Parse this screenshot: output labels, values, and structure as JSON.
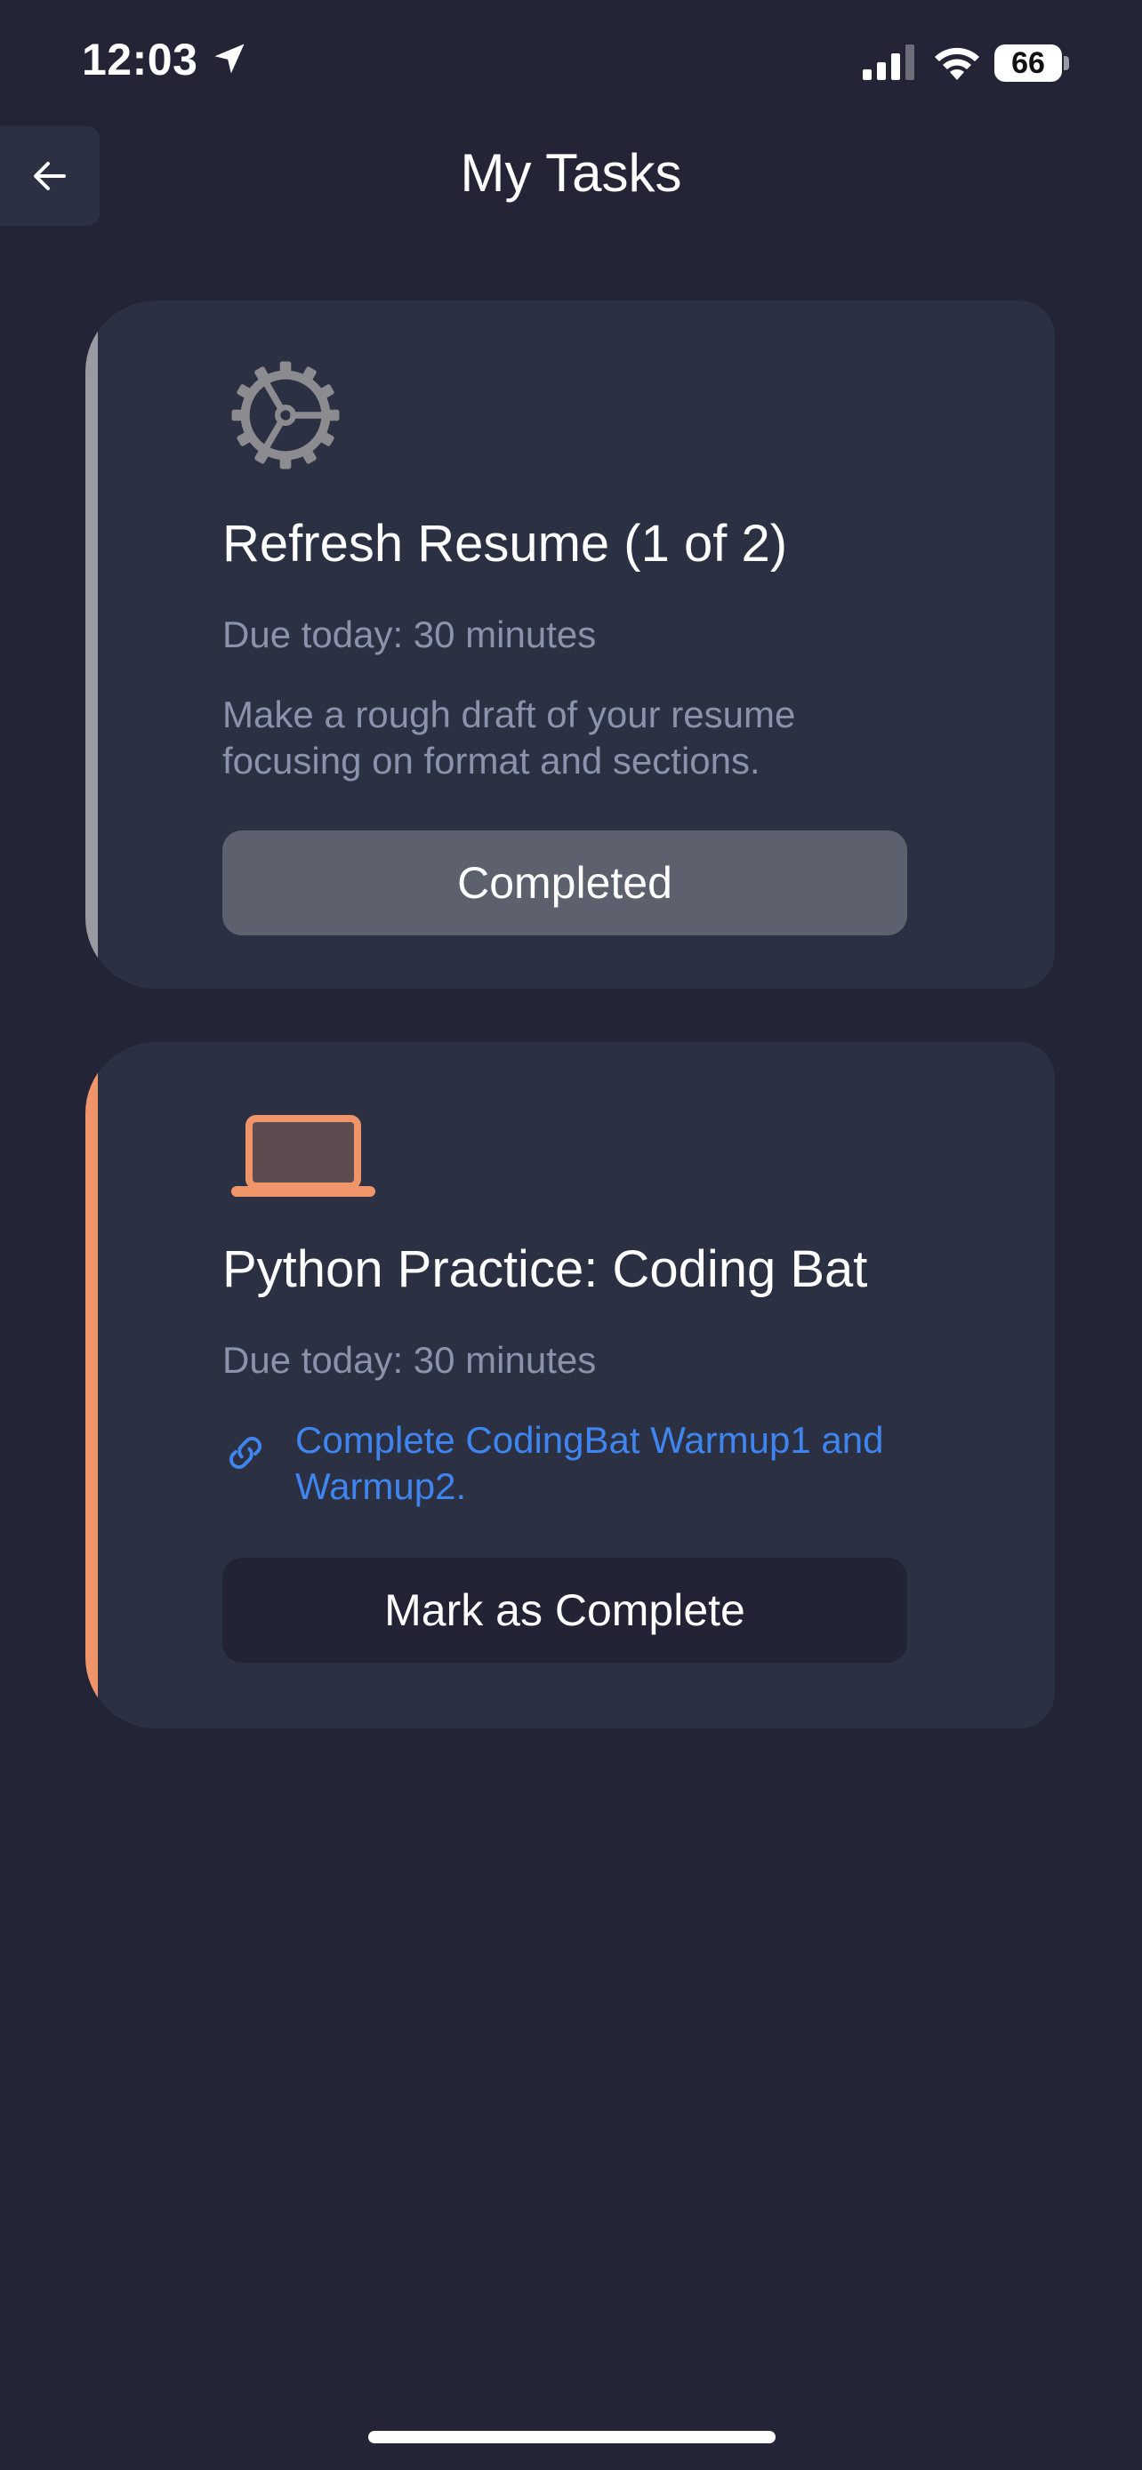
{
  "status_bar": {
    "time": "12:03",
    "battery_level": "66",
    "icons": [
      "location-arrow-icon",
      "cellular-signal-icon",
      "wifi-icon",
      "battery-icon"
    ]
  },
  "header": {
    "title": "My Tasks",
    "back_icon": "arrow-left-icon"
  },
  "tasks": [
    {
      "icon": "gear-icon",
      "title": "Refresh Resume (1 of 2)",
      "due": "Due today: 30 minutes",
      "description": "Make a rough draft of your resume focusing on format and sections.",
      "button_label": "Completed",
      "accent_color": "#9a9ba2",
      "button_color": "#5d606d"
    },
    {
      "icon": "laptop-icon",
      "title": "Python Practice: Coding Bat",
      "due": "Due today: 30 minutes",
      "link_icon": "link-icon",
      "link_text": "Complete CodingBat Warmup1 and Warmup2.",
      "button_label": "Mark as Complete",
      "accent_color": "#f0956a",
      "button_color": "#222436"
    }
  ],
  "colors": {
    "background": "#232536",
    "card": "#2c3043",
    "muted_text": "#8a92ac",
    "link": "#3f85f0"
  }
}
